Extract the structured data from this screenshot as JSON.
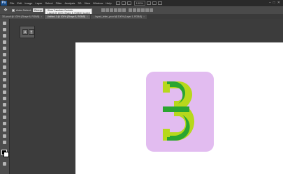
{
  "menu": {
    "items": [
      "File",
      "Edit",
      "Image",
      "Layer",
      "Select",
      "Filter",
      "Analysis",
      "3D",
      "View",
      "Window",
      "Help"
    ],
    "zoom": "100%",
    "window_controls": [
      "–",
      "□",
      "✕"
    ]
  },
  "options": {
    "tool": "move-tool",
    "auto_select_label": "Auto-Select:",
    "auto_select_value": "Group"
  },
  "tooltip": {
    "line1": "Show Transform Controls",
    "line2": "Layout @ 100% (Shape 8, RGB/8) (scaled)"
  },
  "tabs": [
    {
      "label": "3D proof @ 100% (Shape 6, RGB/8)",
      "active": false
    },
    {
      "label": "Untitled-1 @ 100% (Shape 8, RGB/8)",
      "active": true
    },
    {
      "label": "…layout_letter_proof @ 100% (Layer 1, RGB/8)",
      "active": false
    }
  ],
  "icons": {
    "ps_logo": "photoshop-logo",
    "panel_buttons": [
      "character-icon",
      "paragraph-icon"
    ]
  },
  "artwork": {
    "background_color": "#e2bcf0",
    "dark_green": "#2aa531",
    "light_green": "#b7d81c"
  }
}
